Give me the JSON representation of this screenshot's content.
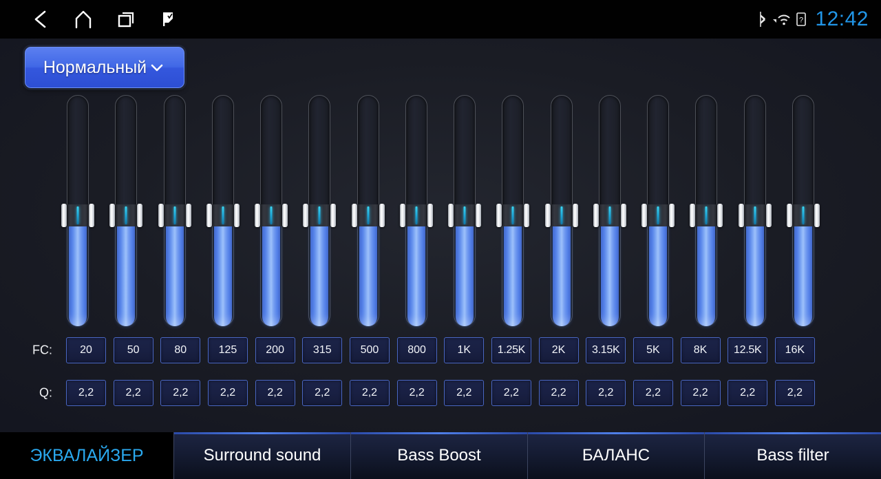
{
  "statusbar": {
    "nav": [
      {
        "name": "back-icon",
        "label": "Back"
      },
      {
        "name": "home-icon",
        "label": "Home"
      },
      {
        "name": "recents-icon",
        "label": "Recents"
      },
      {
        "name": "flag-icon",
        "label": "Flag"
      }
    ],
    "icons": [
      "bluetooth-icon",
      "wifi-icon",
      "sim-icon"
    ],
    "time": "12:42"
  },
  "preset": {
    "label": "Нормальный",
    "chevron": "chevron-down-icon"
  },
  "equalizer": {
    "fc_label": "FC:",
    "q_label": "Q:",
    "bands": [
      {
        "fc": "20",
        "q": "2,2",
        "value": 48
      },
      {
        "fc": "50",
        "q": "2,2",
        "value": 48
      },
      {
        "fc": "80",
        "q": "2,2",
        "value": 48
      },
      {
        "fc": "125",
        "q": "2,2",
        "value": 48
      },
      {
        "fc": "200",
        "q": "2,2",
        "value": 48
      },
      {
        "fc": "315",
        "q": "2,2",
        "value": 48
      },
      {
        "fc": "500",
        "q": "2,2",
        "value": 48
      },
      {
        "fc": "800",
        "q": "2,2",
        "value": 48
      },
      {
        "fc": "1K",
        "q": "2,2",
        "value": 48
      },
      {
        "fc": "1.25K",
        "q": "2,2",
        "value": 48
      },
      {
        "fc": "2K",
        "q": "2,2",
        "value": 48
      },
      {
        "fc": "3.15K",
        "q": "2,2",
        "value": 48
      },
      {
        "fc": "5K",
        "q": "2,2",
        "value": 48
      },
      {
        "fc": "8K",
        "q": "2,2",
        "value": 48
      },
      {
        "fc": "12.5K",
        "q": "2,2",
        "value": 48
      },
      {
        "fc": "16K",
        "q": "2,2",
        "value": 48
      }
    ]
  },
  "tabs": [
    {
      "label": "ЭКВАЛАЙЗЕР",
      "active": true
    },
    {
      "label": "Surround sound",
      "active": false
    },
    {
      "label": "Bass Boost",
      "active": false
    },
    {
      "label": "БАЛАНС",
      "active": false
    },
    {
      "label": "Bass filter",
      "active": false
    }
  ],
  "colors": {
    "accent_blue": "#4168e6",
    "active_tab_text": "#2aa8ee",
    "clock": "#2196e8",
    "slider_fill": "#8ab2f7",
    "cell_border": "#4a67c4",
    "background": "#1a1c24"
  }
}
